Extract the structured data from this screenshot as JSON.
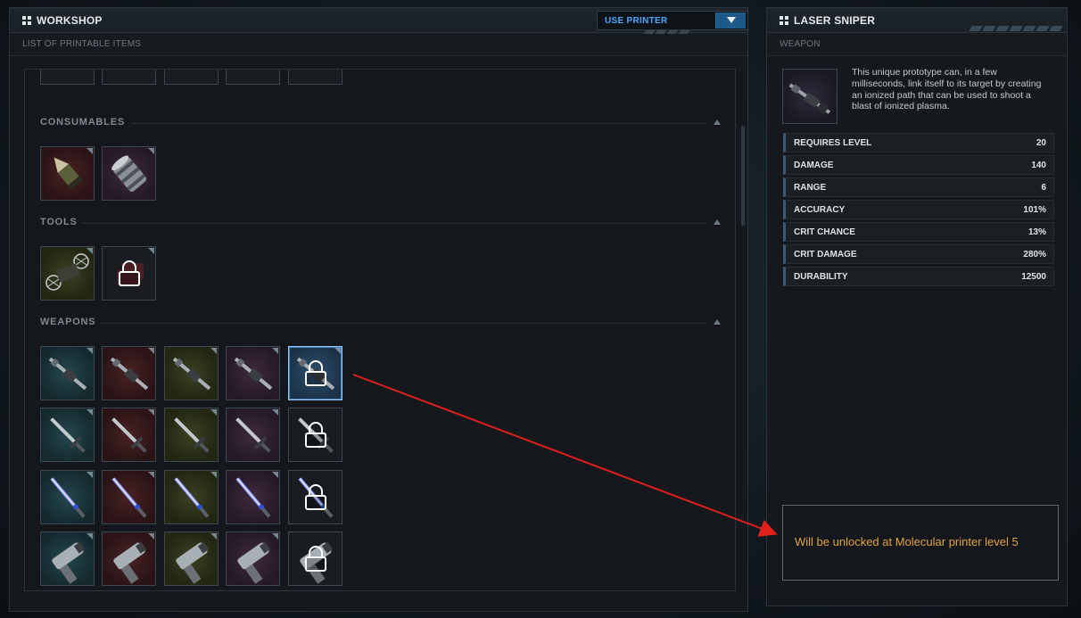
{
  "workshop": {
    "title": "WORKSHOP",
    "subtitle": "LIST OF PRINTABLE ITEMS",
    "printer_select": {
      "label": "USE PRINTER"
    },
    "categories": [
      {
        "label": "CONSUMABLES"
      },
      {
        "label": "TOOLS"
      },
      {
        "label": "WEAPONS"
      }
    ]
  },
  "detail": {
    "title": "LASER SNIPER",
    "subtitle": "WEAPON",
    "description": "This unique prototype can, in a few milliseconds, link itself to its target by creating an ionized path that can be used to shoot a blast of ionized plasma.",
    "stats": [
      {
        "key": "REQUIRES LEVEL",
        "value": "20"
      },
      {
        "key": "DAMAGE",
        "value": "140"
      },
      {
        "key": "RANGE",
        "value": "6"
      },
      {
        "key": "ACCURACY",
        "value": "101%"
      },
      {
        "key": "CRIT CHANCE",
        "value": "13%"
      },
      {
        "key": "CRIT DAMAGE",
        "value": "280%"
      },
      {
        "key": "DURABILITY",
        "value": "12500"
      }
    ],
    "unlock_message": "Will be unlocked at Molecular printer level 5"
  },
  "colors": {
    "accent_blue": "#4aa8ff",
    "unlock_text": "#e2a43a",
    "annotation_arrow": "#e0201c"
  }
}
